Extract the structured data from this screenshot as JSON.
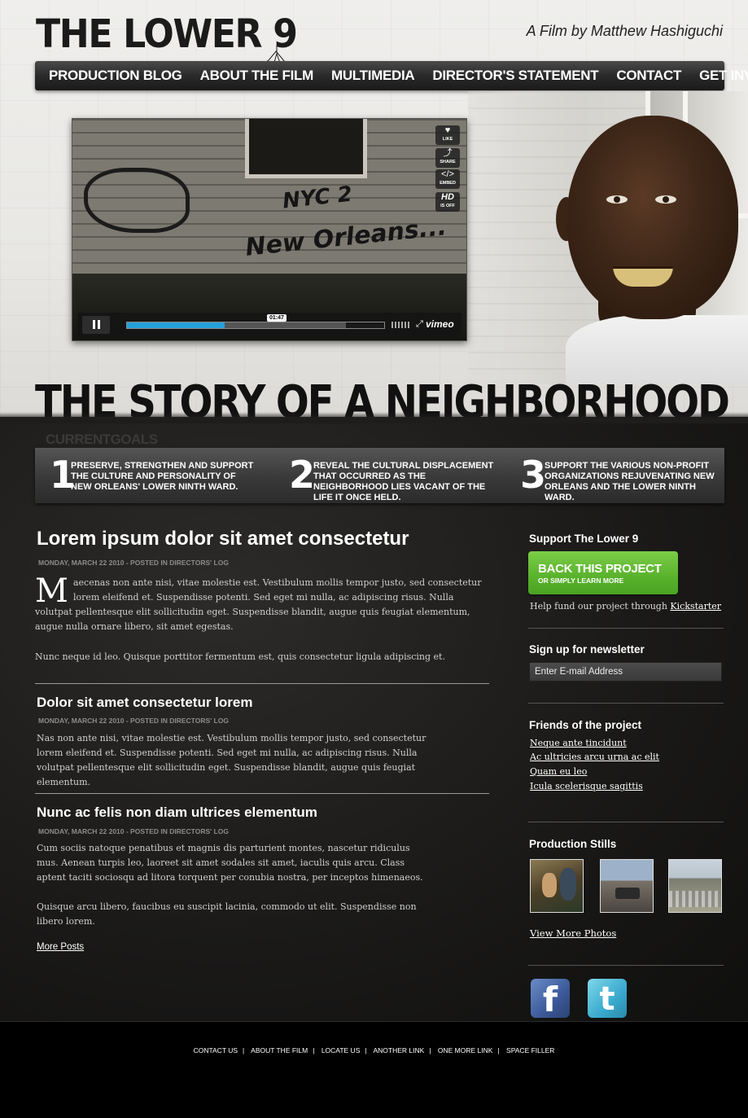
{
  "header": {
    "logo_text": "THE LOWER",
    "logo_number": "9",
    "byline": "A Film by Matthew Hashiguchi"
  },
  "nav": {
    "items": [
      "PRODUCTION BLOG",
      "ABOUT THE FILM",
      "MULTIMEDIA",
      "DIRECTOR'S STATEMENT",
      "CONTACT",
      "GET INVOLVED"
    ]
  },
  "video": {
    "buttons": [
      {
        "glyph": "♥",
        "label": "LIKE",
        "icon": "heart-icon"
      },
      {
        "glyph": "⤴",
        "label": "SHARE",
        "icon": "share-icon"
      },
      {
        "glyph": "</>",
        "label": "EMBED",
        "icon": "embed-icon"
      },
      {
        "glyph": "HD",
        "label": "IS OFF",
        "icon": "hd-icon"
      }
    ],
    "timestamp": "01:47",
    "progress": 0.38,
    "buffered": 0.85,
    "brand": "vimeo",
    "graffiti_line1": "NYC 2",
    "graffiti_line2": "New Orleans..."
  },
  "headline": "THE STORY OF A NEIGHBORHOOD",
  "goals": {
    "label": "CURRENTGOALS",
    "items": [
      {
        "num": "1",
        "text": "PRESERVE, STRENGTHEN AND SUPPORT THE CULTURE AND PERSONALITY OF NEW ORLEANS' LOWER NINTH WARD."
      },
      {
        "num": "2",
        "text": "REVEAL THE CULTURAL DISPLACEMENT THAT OCCURRED AS THE NEIGHBORHOOD LIES VACANT OF THE LIFE IT ONCE HELD."
      },
      {
        "num": "3",
        "text": "SUPPORT THE VARIOUS NON-PROFIT ORGANIZATIONS REJUVENATING NEW ORLEANS AND THE LOWER NINTH WARD."
      }
    ]
  },
  "posts": [
    {
      "title": "Lorem ipsum dolor sit amet consectetur",
      "meta": "MONDAY, MARCH 22 2010 - POSTED IN DIRECTORS' LOG",
      "dropcap": "M",
      "para1": "aecenas non ante nisi, vitae molestie est. Vestibulum mollis tempor justo, sed consectetur lorem eleifend et. Suspendisse potenti. Sed eget mi nulla, ac adipiscing risus. Nulla volutpat pellentesque elit sollicitudin eget. Suspendisse blandit, augue quis feugiat elementum, augue nulla ornare libero, sit amet egestas.",
      "para2": "Nunc neque id leo. Quisque porttitor fermentum est, quis consectetur ligula adipiscing et."
    },
    {
      "title": "Dolor sit amet consectetur lorem",
      "meta": "MONDAY, MARCH 22 2010 - POSTED IN DIRECTORS' LOG",
      "para1": "Nas non ante nisi, vitae molestie est. Vestibulum mollis tempor justo, sed consectetur lorem eleifend et. Suspendisse potenti. Sed eget mi nulla, ac adipiscing risus. Nulla volutpat pellentesque elit sollicitudin eget. Suspendisse blandit, augue quis feugiat elementum."
    },
    {
      "title": "Nunc ac felis non diam ultrices elementum",
      "meta": "MONDAY, MARCH 22 2010 - POSTED IN DIRECTORS' LOG",
      "para1": "Cum sociis natoque penatibus et magnis dis parturient montes, nascetur ridiculus mus. Aenean turpis leo, laoreet sit amet sodales sit amet, iaculis quis arcu. Class aptent taciti sociosqu ad litora torquent per conubia nostra, per inceptos himenaeos.",
      "para2": "Quisque arcu libero, faucibus eu suscipit lacinia, commodo ut elit. Suspendisse non libero lorem."
    }
  ],
  "more_posts": "More Posts",
  "sidebar": {
    "support_heading": "Support The Lower 9",
    "back_big": "BACK THIS PROJECT",
    "back_small": "OR SIMPLY LEARN MORE",
    "help_text": "Help fund our project through ",
    "help_link": "Kickstarter",
    "newsletter_heading": "Sign up for newsletter",
    "email_placeholder": "Enter E-mail Address",
    "friends_heading": "Friends of the project",
    "friends": [
      "Neque ante tincidunt",
      "Ac ultricies arcu urna ac elit",
      "Quam eu leo",
      "Icula scelerisque sagittis"
    ],
    "stills_heading": "Production Stills",
    "view_more": "View More Photos",
    "facebook_glyph": "f",
    "twitter_glyph": "t"
  },
  "footer": {
    "links": [
      "CONTACT US",
      "ABOUT THE FILM",
      "LOCATE US",
      "ANOTHER LINK",
      "ONE MORE LINK",
      "SPACE FILLER"
    ]
  },
  "colors": {
    "accent_green": "#5ab42d",
    "video_progress": "#26a0da",
    "facebook": "#3b5998",
    "twitter": "#3aaacf"
  }
}
